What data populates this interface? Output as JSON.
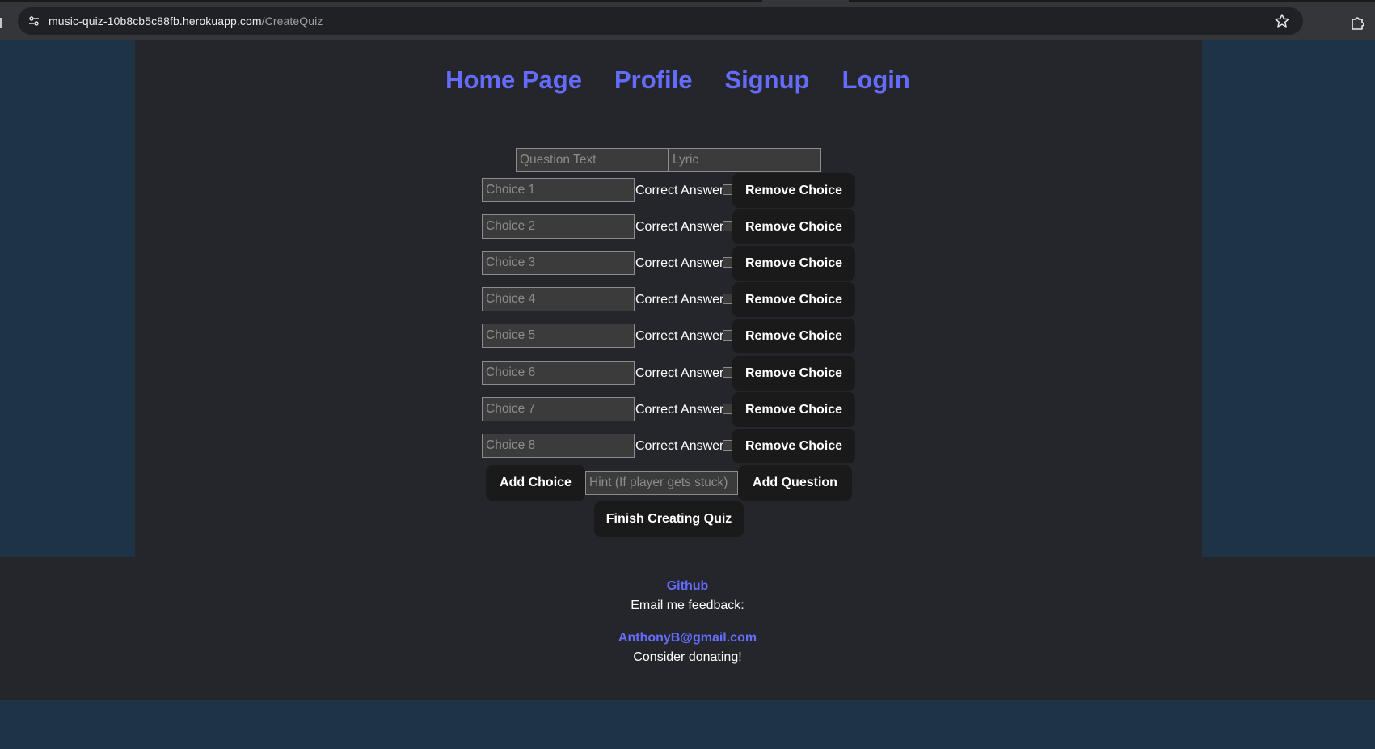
{
  "browser": {
    "url_host": "music-quiz-10b8cb5c88fb.herokuapp.com",
    "url_path": "/CreateQuiz",
    "icons": [
      "site-info-icon",
      "star-icon",
      "extensions-icon"
    ]
  },
  "nav": {
    "items": [
      {
        "label": "Home Page"
      },
      {
        "label": "Profile"
      },
      {
        "label": "Signup"
      },
      {
        "label": "Login"
      }
    ]
  },
  "form": {
    "question_placeholder": "Question Text",
    "lyric_placeholder": "Lyric",
    "correct_answer_label": "Correct Answer",
    "remove_choice_label": "Remove Choice",
    "choices": [
      {
        "placeholder": "Choice 1",
        "checked": false
      },
      {
        "placeholder": "Choice 2",
        "checked": false
      },
      {
        "placeholder": "Choice 3",
        "checked": false
      },
      {
        "placeholder": "Choice 4",
        "checked": false
      },
      {
        "placeholder": "Choice 5",
        "checked": false
      },
      {
        "placeholder": "Choice 6",
        "checked": false
      },
      {
        "placeholder": "Choice 7",
        "checked": false
      },
      {
        "placeholder": "Choice 8",
        "checked": false
      }
    ],
    "add_choice_label": "Add Choice",
    "hint_placeholder": "Hint (If player gets stuck)",
    "add_question_label": "Add Question",
    "finish_label": "Finish Creating Quiz"
  },
  "footer": {
    "github_label": "Github",
    "email_prompt": "Email me feedback:",
    "email": "AnthonyB@gmail.com",
    "donate_text": "Consider donating!"
  },
  "colors": {
    "accent": "#646cff",
    "page_bg": "#1f3347",
    "panel_bg": "#24262b",
    "button_bg": "#1a1a1a"
  }
}
